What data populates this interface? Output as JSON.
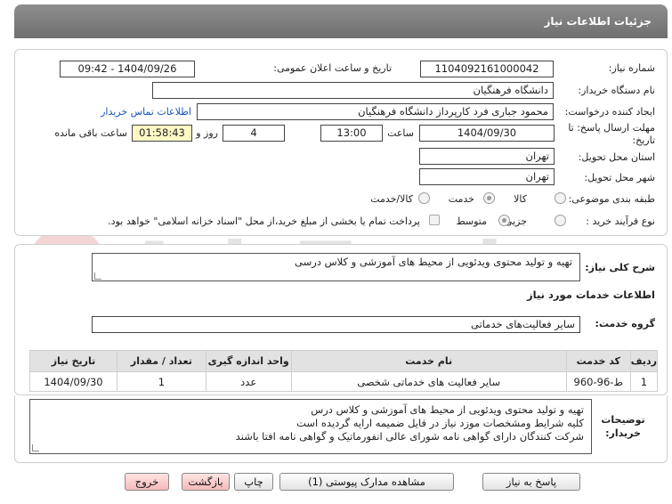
{
  "header": {
    "title": "جزئیات اطلاعات نیاز"
  },
  "form": {
    "need_number_label": "شماره نیاز:",
    "need_number": "1104092161000042",
    "announce_label": "تاریخ و ساعت اعلان عمومی:",
    "announce_value": "1404/09/26 - 09:42",
    "buyer_org_label": "نام دستگاه خریدار:",
    "buyer_org": "دانشگاه فرهنگیان",
    "creator_label": "ایجاد کننده درخواست:",
    "creator": "محمود جباری فرد کارپرداز دانشگاه فرهنگیان",
    "contact_link": "اطلاعات تماس خریدار",
    "deadline_label": "مهلت ارسال پاسخ: تا تاریخ:",
    "deadline_date": "1404/09/30",
    "time_label": "ساعت",
    "deadline_time": "13:00",
    "days_value": "4",
    "days_label": "روز و",
    "remaining_time": "01:58:43",
    "remaining_label": "ساعت باقی مانده",
    "province_label": "استان محل تحویل:",
    "province": "تهران",
    "city_label": "شهر محل تحویل:",
    "city": "تهران",
    "category_label": "طبقه بندی موضوعی:",
    "category_options": [
      "کالا",
      "خدمت",
      "کالا/خدمت"
    ],
    "process_label": "نوع فرآیند خرید :",
    "process_options": [
      "جزیی",
      "متوسط"
    ],
    "payment_note": "پرداخت تمام یا بخشی از مبلغ خرید،از محل \"اسناد خزانه اسلامی\" خواهد بود."
  },
  "summary": {
    "label": "شرح کلی نیاز:",
    "text": "تهیه و تولید محتوی ویدئویی از محیط های آموزشی و کلاس درسی"
  },
  "services": {
    "section_title": "اطلاعات خدمات مورد نیاز",
    "group_label": "گروه خدمت:",
    "group_value": "سایر فعالیت‌های خدماتی",
    "table": {
      "headers": [
        "ردیف",
        "کد خدمت",
        "نام خدمت",
        "واحد اندازه گیری",
        "تعداد / مقدار",
        "تاریخ نیاز"
      ],
      "rows": [
        [
          "1",
          "ط-96-960",
          "سایر فعالیت های خدماتی شخصی",
          "عدد",
          "1",
          "1404/09/30"
        ]
      ]
    }
  },
  "buyer_notes": {
    "label": "توضیحات خریدار:",
    "lines": [
      "تهیه و تولید محتوی ویدئویی از محیط های آموزشی و کلاس درس",
      "کلیه شرایط ومشخصات موزد نیاز در فایل ضمیمه ارایه گردیده است",
      "شرکت کنندگان دارای  گواهی نامه شورای عالی انفورماتیک و گواهی نامه افتا باشند"
    ]
  },
  "buttons": {
    "reply": "پاسخ به نیاز",
    "attachments": "مشاهده مدارک پیوستی (1)",
    "print": "چاپ",
    "back": "بازگشت",
    "exit": "خروج"
  },
  "watermark": {
    "text": "AriaTender.net"
  },
  "colors": {
    "title_bar": "#7a7a7a",
    "time_highlight": "#fff8c6",
    "link": "#1556b8",
    "pink_button": "#f6b9b9"
  }
}
